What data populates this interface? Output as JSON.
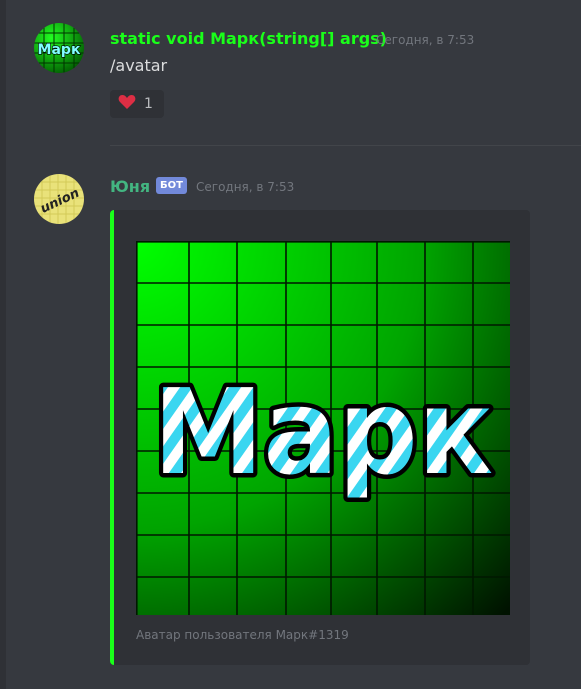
{
  "messages": [
    {
      "username": "static void Марк(string[] args)",
      "username_color": "#1aff1a",
      "timestamp": "Сегодня, в 7:53",
      "content": "/avatar",
      "avatar_text": "Марк",
      "reaction": {
        "emoji": "heart-icon",
        "count": "1"
      }
    },
    {
      "username": "Юня",
      "username_color": "#43b581",
      "bot_tag": "БОТ",
      "timestamp": "Сегодня, в 7:53",
      "avatar_text": "union",
      "embed": {
        "border_color": "#1aff1a",
        "image_text": "Марк",
        "footer": "Аватар пользователя Марк#1319"
      }
    }
  ]
}
